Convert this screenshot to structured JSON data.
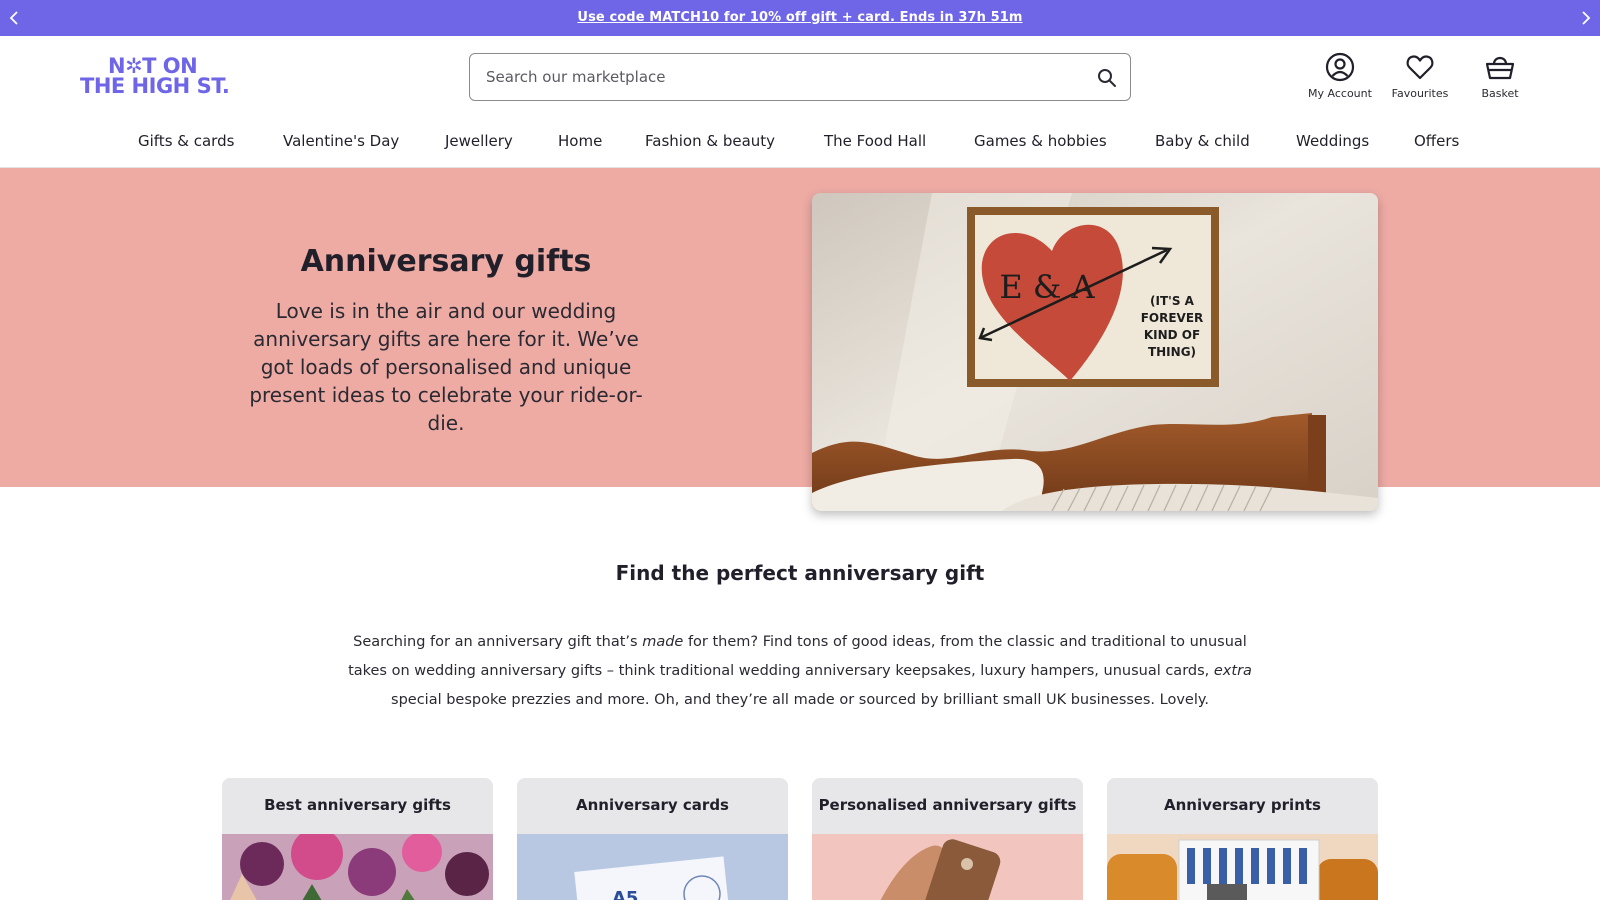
{
  "promo": {
    "text": "Use code MATCH10 for 10% off gift + card. Ends in 37h 51m"
  },
  "logo": {
    "line1": "N✲T ON",
    "line2": "THE HIGH ST.",
    "alt": "NOT ON THE HIGH ST."
  },
  "search": {
    "placeholder": "Search our marketplace"
  },
  "header_actions": {
    "account": "My Account",
    "favourites": "Favourites",
    "basket": "Basket"
  },
  "nav": {
    "items": [
      "Gifts & cards",
      "Valentine's Day",
      "Jewellery",
      "Home",
      "Fashion & beauty",
      "The Food Hall",
      "Games & hobbies",
      "Baby & child",
      "Weddings",
      "Offers"
    ]
  },
  "hero": {
    "title": "Anniversary gifts",
    "text": "Love is in the air and our wedding anniversary gifts are here for it. We’ve got loads of personalised and unique present ideas to celebrate your ride-or-die.",
    "image_print_initials": "E & A",
    "image_print_caption": [
      "(IT'S A",
      "FOREVER",
      "KIND OF",
      "THING)"
    ]
  },
  "intro": {
    "title": "Find the perfect anniversary gift",
    "p1": "Searching for an anniversary gift that’s ",
    "em1": "made",
    "p2": " for them? Find tons of good ideas, from the classic and traditional to unusual takes on wedding anniversary gifts – think traditional wedding anniversary keepsakes, luxury hampers, unusual cards, ",
    "em2": "extra",
    "p3": " special bespoke prezzies and more. Oh, and they’re all made or sourced by brilliant small UK businesses. Lovely."
  },
  "cards": [
    {
      "title": "Best anniversary gifts"
    },
    {
      "title": "Anniversary cards",
      "image_text": "A5"
    },
    {
      "title": "Personalised anniversary gifts"
    },
    {
      "title": "Anniversary prints"
    }
  ],
  "colors": {
    "brand": "#6e66e6",
    "hero_bg": "#eeaba4",
    "card_header": "#e7e7e9",
    "text": "#211f2a"
  }
}
